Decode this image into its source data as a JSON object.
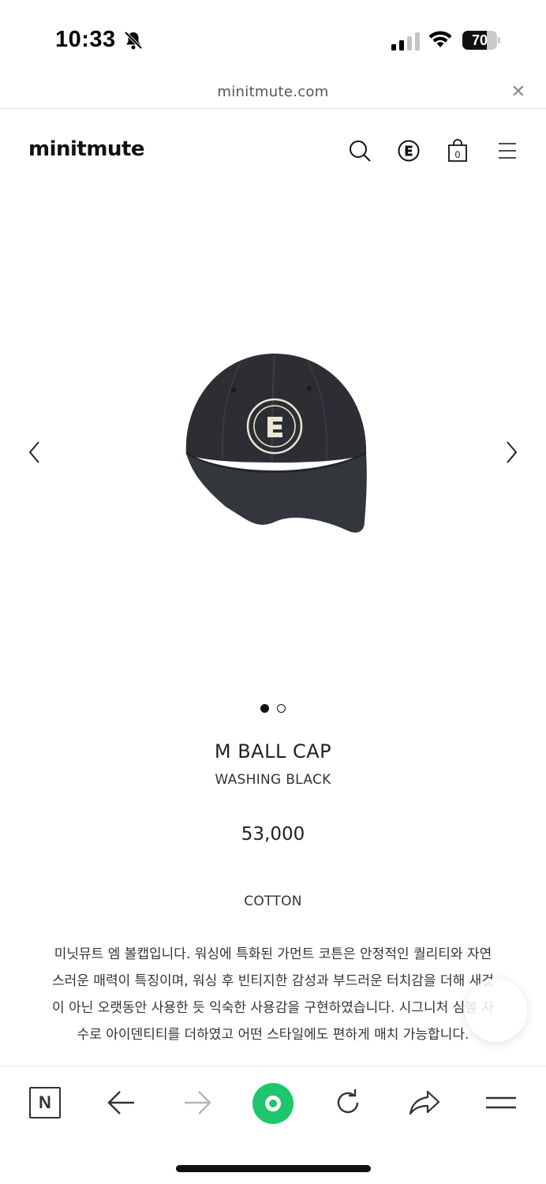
{
  "status_bar": {
    "time": "10:33",
    "battery_level": "70",
    "battery_fraction": 0.7,
    "icons": [
      "bell-muted-icon",
      "cellular-signal-icon",
      "wifi-icon",
      "battery-icon"
    ]
  },
  "browser": {
    "url": "minitmute.com",
    "close_symbol": "✕"
  },
  "header": {
    "logo": "minitmute",
    "icons": [
      "search-icon",
      "brand-e-icon",
      "shopping-bag-icon",
      "hamburger-menu-icon"
    ],
    "cart_count": "0"
  },
  "carousel": {
    "image": "black-baseball-cap-product-photo",
    "current_index": 1,
    "total": 2,
    "prev_icon": "chevron-left-icon",
    "next_icon": "chevron-right-icon"
  },
  "product": {
    "name": "M BALL CAP",
    "color": "WASHING BLACK",
    "price": "53,000",
    "material": "COTTON",
    "description": "미닛뮤트 엠 볼캡입니다. 워싱에 특화된 가먼트 코튼은 안정적인 퀄리티와 자연스러운 매력이 특징이며, 워싱 후 빈티지한 감성과 부드러운 터치감을 더해 새것이 아닌 오랫동안 사용한 듯 익숙한 사용감을 구현하였습니다. 시그니처 심볼 자수로 아이덴티티를 더하였고 어떤 스타일에도 편하게 매치 가능합니다."
  },
  "toolbar": {
    "n_label": "N",
    "icons": [
      "naver-n-icon",
      "back-arrow-icon",
      "forward-arrow-icon",
      "green-dot-icon",
      "reload-icon",
      "share-icon",
      "menu-icon"
    ]
  },
  "colors": {
    "accent_green": "#1fc66b",
    "text": "#222222",
    "cap": "#2b2d31"
  }
}
